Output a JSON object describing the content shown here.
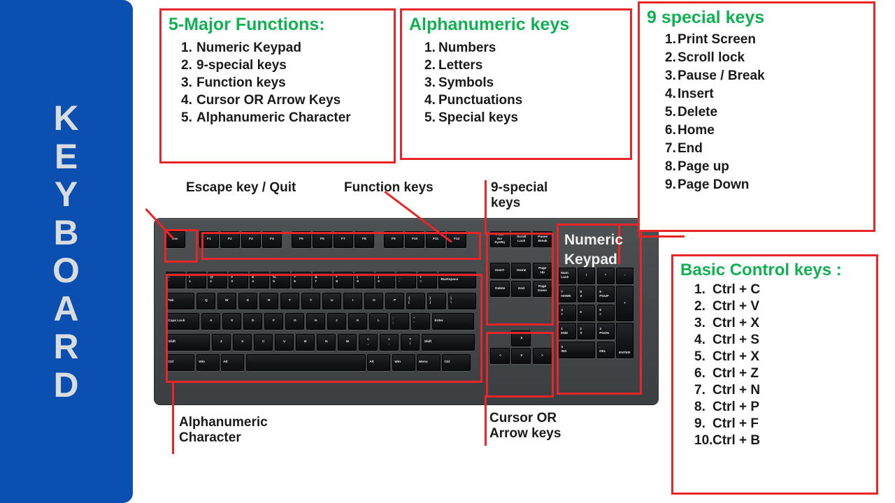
{
  "banner": {
    "word": "KEYBOARD",
    "letters": [
      "K",
      "E",
      "Y",
      "B",
      "O",
      "A",
      "R",
      "D"
    ],
    "background_color": "#0b4fb0",
    "text_color": "#d8dcdf"
  },
  "theme": {
    "accent_red": "#e8262a",
    "heading_green": "#10b152",
    "body_black": "#1a1a1a",
    "keyboard_body": "#45484a",
    "key_black": "#141519"
  },
  "boxes": {
    "major_functions": {
      "title": "5-Major Functions:",
      "items": [
        {
          "num": "1.",
          "text": "Numeric Keypad"
        },
        {
          "num": "2.",
          "text": "9-special keys"
        },
        {
          "num": "3.",
          "text": "Function keys"
        },
        {
          "num": "4.",
          "text": "Cursor OR Arrow Keys"
        },
        {
          "num": "5.",
          "text": "Alphanumeric Character"
        }
      ]
    },
    "alphanumeric_keys": {
      "title": "Alphanumeric keys",
      "items": [
        {
          "num": "1.",
          "text": "Numbers"
        },
        {
          "num": "2.",
          "text": "Letters"
        },
        {
          "num": "3.",
          "text": "Symbols"
        },
        {
          "num": "4.",
          "text": "Punctuations"
        },
        {
          "num": "5.",
          "text": "Special keys"
        }
      ]
    },
    "special_keys": {
      "title": "9 special keys",
      "items": [
        {
          "num": "1.",
          "text": "Print Screen"
        },
        {
          "num": "2.",
          "text": "Scroll lock"
        },
        {
          "num": "3.",
          "text": "Pause / Break"
        },
        {
          "num": "4.",
          "text": "Insert"
        },
        {
          "num": "5.",
          "text": "Delete"
        },
        {
          "num": "6.",
          "text": "Home"
        },
        {
          "num": "7.",
          "text": "End"
        },
        {
          "num": "8.",
          "text": "Page up"
        },
        {
          "num": "9.",
          "text": "Page Down"
        }
      ]
    },
    "basic_control_keys": {
      "title": "Basic Control keys :",
      "items": [
        {
          "num": "1.",
          "text": "Ctrl + C"
        },
        {
          "num": "2.",
          "text": "Ctrl + V"
        },
        {
          "num": "3.",
          "text": "Ctrl + X"
        },
        {
          "num": "4.",
          "text": "Ctrl + S"
        },
        {
          "num": "5.",
          "text": "Ctrl + X"
        },
        {
          "num": "6.",
          "text": "Ctrl + Z"
        },
        {
          "num": "7.",
          "text": "Ctrl + N"
        },
        {
          "num": "8.",
          "text": "Ctrl + P"
        },
        {
          "num": "9.",
          "text": "Ctrl + F"
        },
        {
          "num": "10.",
          "text": "Ctrl + B"
        }
      ]
    }
  },
  "callouts": {
    "escape": "Escape key / Quit",
    "function_keys": "Function keys",
    "nine_special": "9-special\nkeys",
    "numeric_keypad": "Numeric\nKeypad",
    "alphanumeric": "Alphanumeric\nCharacter",
    "cursor": "Cursor OR\nArrow keys"
  },
  "keyboard": {
    "escape_key": "Esc",
    "function_keys": [
      "F1",
      "F2",
      "F3",
      "F4",
      "F5",
      "F6",
      "F7",
      "F8",
      "F9",
      "F10",
      "F11",
      "F12"
    ],
    "number_row": [
      "~\n`",
      "!\n1",
      "@\n2",
      "#\n3",
      "$\n4",
      "%\n5",
      "^\n6",
      "&\n7",
      "*\n8",
      "(\n9",
      ")\n0",
      "_\n-",
      "+\n=",
      "Backspace"
    ],
    "row_qwerty": [
      "Tab",
      "Q",
      "W",
      "E",
      "R",
      "T",
      "Y",
      "U",
      "I",
      "O",
      "P",
      "{\n[",
      "}\n]",
      "|\n\\"
    ],
    "row_home": [
      "Caps Lock",
      "A",
      "S",
      "D",
      "F",
      "G",
      "H",
      "J",
      "K",
      "L",
      ":\n;",
      "\"\n'",
      "Enter"
    ],
    "row_shift": [
      "Shift",
      "Z",
      "X",
      "C",
      "V",
      "B",
      "N",
      "M",
      "<\n,",
      ">\n.",
      "?\n/",
      "Shift"
    ],
    "row_bottom": [
      "Ctrl",
      "Win",
      "Alt",
      "",
      "Alt",
      "Win",
      "Menu",
      "Ctrl"
    ],
    "nav_cluster": [
      "Print\nScr\nSysRq",
      "Scroll\nLock",
      "Pause\nBreak",
      "Insert",
      "Home",
      "Page\nUp",
      "Delete",
      "End",
      "Page\nDown"
    ],
    "arrow_keys": [
      "∧",
      "<",
      "∨",
      ">"
    ],
    "numpad": [
      "Num\nLock",
      "/",
      "*",
      "-",
      "7\nHOME",
      "8\n∧",
      "9\nPGUP",
      "+",
      "4\n<",
      "5",
      "6\n>",
      "1\nEND",
      "2\n∨",
      "3\nPGDN",
      "ENTER",
      "0\nINS",
      ".\nDEL"
    ]
  }
}
